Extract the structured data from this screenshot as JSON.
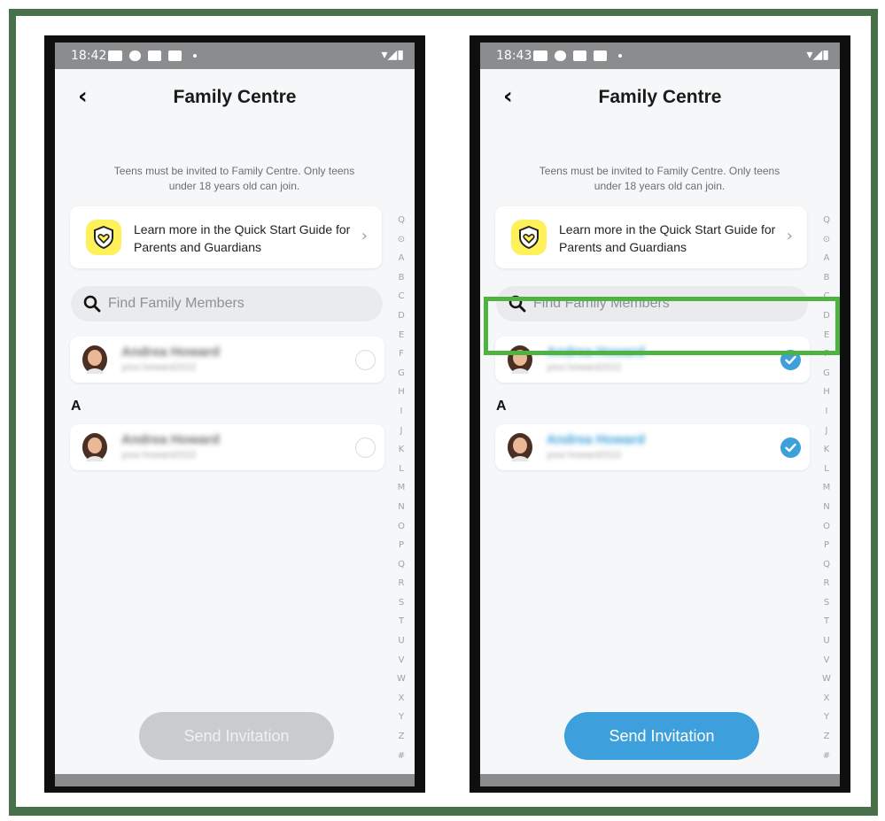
{
  "screens": [
    {
      "status_time": "18:42",
      "title": "Family Centre",
      "subtitle": "Teens must be invited to Family Centre. Only teens under 18 years old can join.",
      "guide_text": "Learn more in the Quick Start Guide for Parents and Guardians",
      "search_placeholder": "Find Family Members",
      "section_label": "A",
      "contacts": [
        {
          "name": "Andrea Howard",
          "username": "your.howard2022",
          "selected": false
        },
        {
          "name": "Andrea Howard",
          "username": "your.howard2022",
          "selected": false
        }
      ],
      "send_label": "Send Invitation",
      "send_enabled": false
    },
    {
      "status_time": "18:43",
      "title": "Family Centre",
      "subtitle": "Teens must be invited to Family Centre. Only teens under 18 years old can join.",
      "guide_text": "Learn more in the Quick Start Guide for Parents and Guardians",
      "search_placeholder": "Find Family Members",
      "section_label": "A",
      "contacts": [
        {
          "name": "Andrea Howard",
          "username": "your.howard2022",
          "selected": true
        },
        {
          "name": "Andrea Howard",
          "username": "your.howard2022",
          "selected": true
        }
      ],
      "send_label": "Send Invitation",
      "send_enabled": true
    }
  ],
  "alpha_index": [
    "Q",
    "⊙",
    "A",
    "B",
    "C",
    "D",
    "E",
    "F",
    "G",
    "H",
    "I",
    "J",
    "K",
    "L",
    "M",
    "N",
    "O",
    "P",
    "Q",
    "R",
    "S",
    "T",
    "U",
    "V",
    "W",
    "X",
    "Y",
    "Z",
    "#"
  ],
  "colors": {
    "outer_frame": "#487049",
    "accent_blue": "#3d9fdb",
    "highlight_green": "#4fb341",
    "guide_icon_yellow": "#fff15a"
  }
}
